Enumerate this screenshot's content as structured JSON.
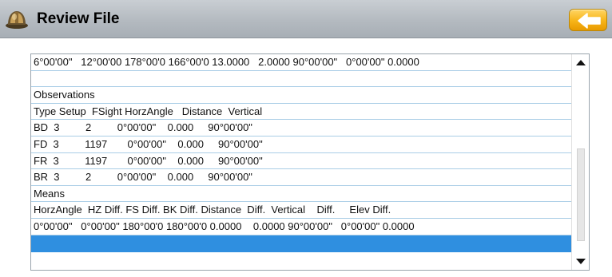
{
  "header": {
    "title": "Review File",
    "icon": "hard-hat-icon",
    "back_icon": "arrow-left-icon",
    "accent_color": "#f7b418"
  },
  "rows": [
    "6°00'00\"   12°00'00 178°00'0 166°00'0 13.0000   2.0000 90°00'00\"   0°00'00\" 0.0000",
    "",
    "Observations",
    "Type Setup  FSight HorzAngle   Distance  Vertical",
    "BD  3         2         0°00'00\"    0.000     90°00'00\"",
    "FD  3         1197       0°00'00\"    0.000     90°00'00\"",
    "FR  3         1197       0°00'00\"    0.000     90°00'00\"",
    "BR  3         2         0°00'00\"    0.000     90°00'00\"",
    "Means",
    "HorzAngle  HZ Diff. FS Diff. BK Diff. Distance  Diff.  Vertical    Diff.     Elev Diff.",
    "0°00'00\"   0°00'00\" 180°00'0 180°00'0 0.0000    0.0000 90°00'00\"   0°00'00\" 0.0000",
    ""
  ],
  "selected_row": 11,
  "scroll": {
    "up_icon": "triangle-up-icon",
    "down_icon": "triangle-down-icon"
  },
  "colors": {
    "selection": "#2f8fe0",
    "row_divider": "#a9cde6"
  }
}
